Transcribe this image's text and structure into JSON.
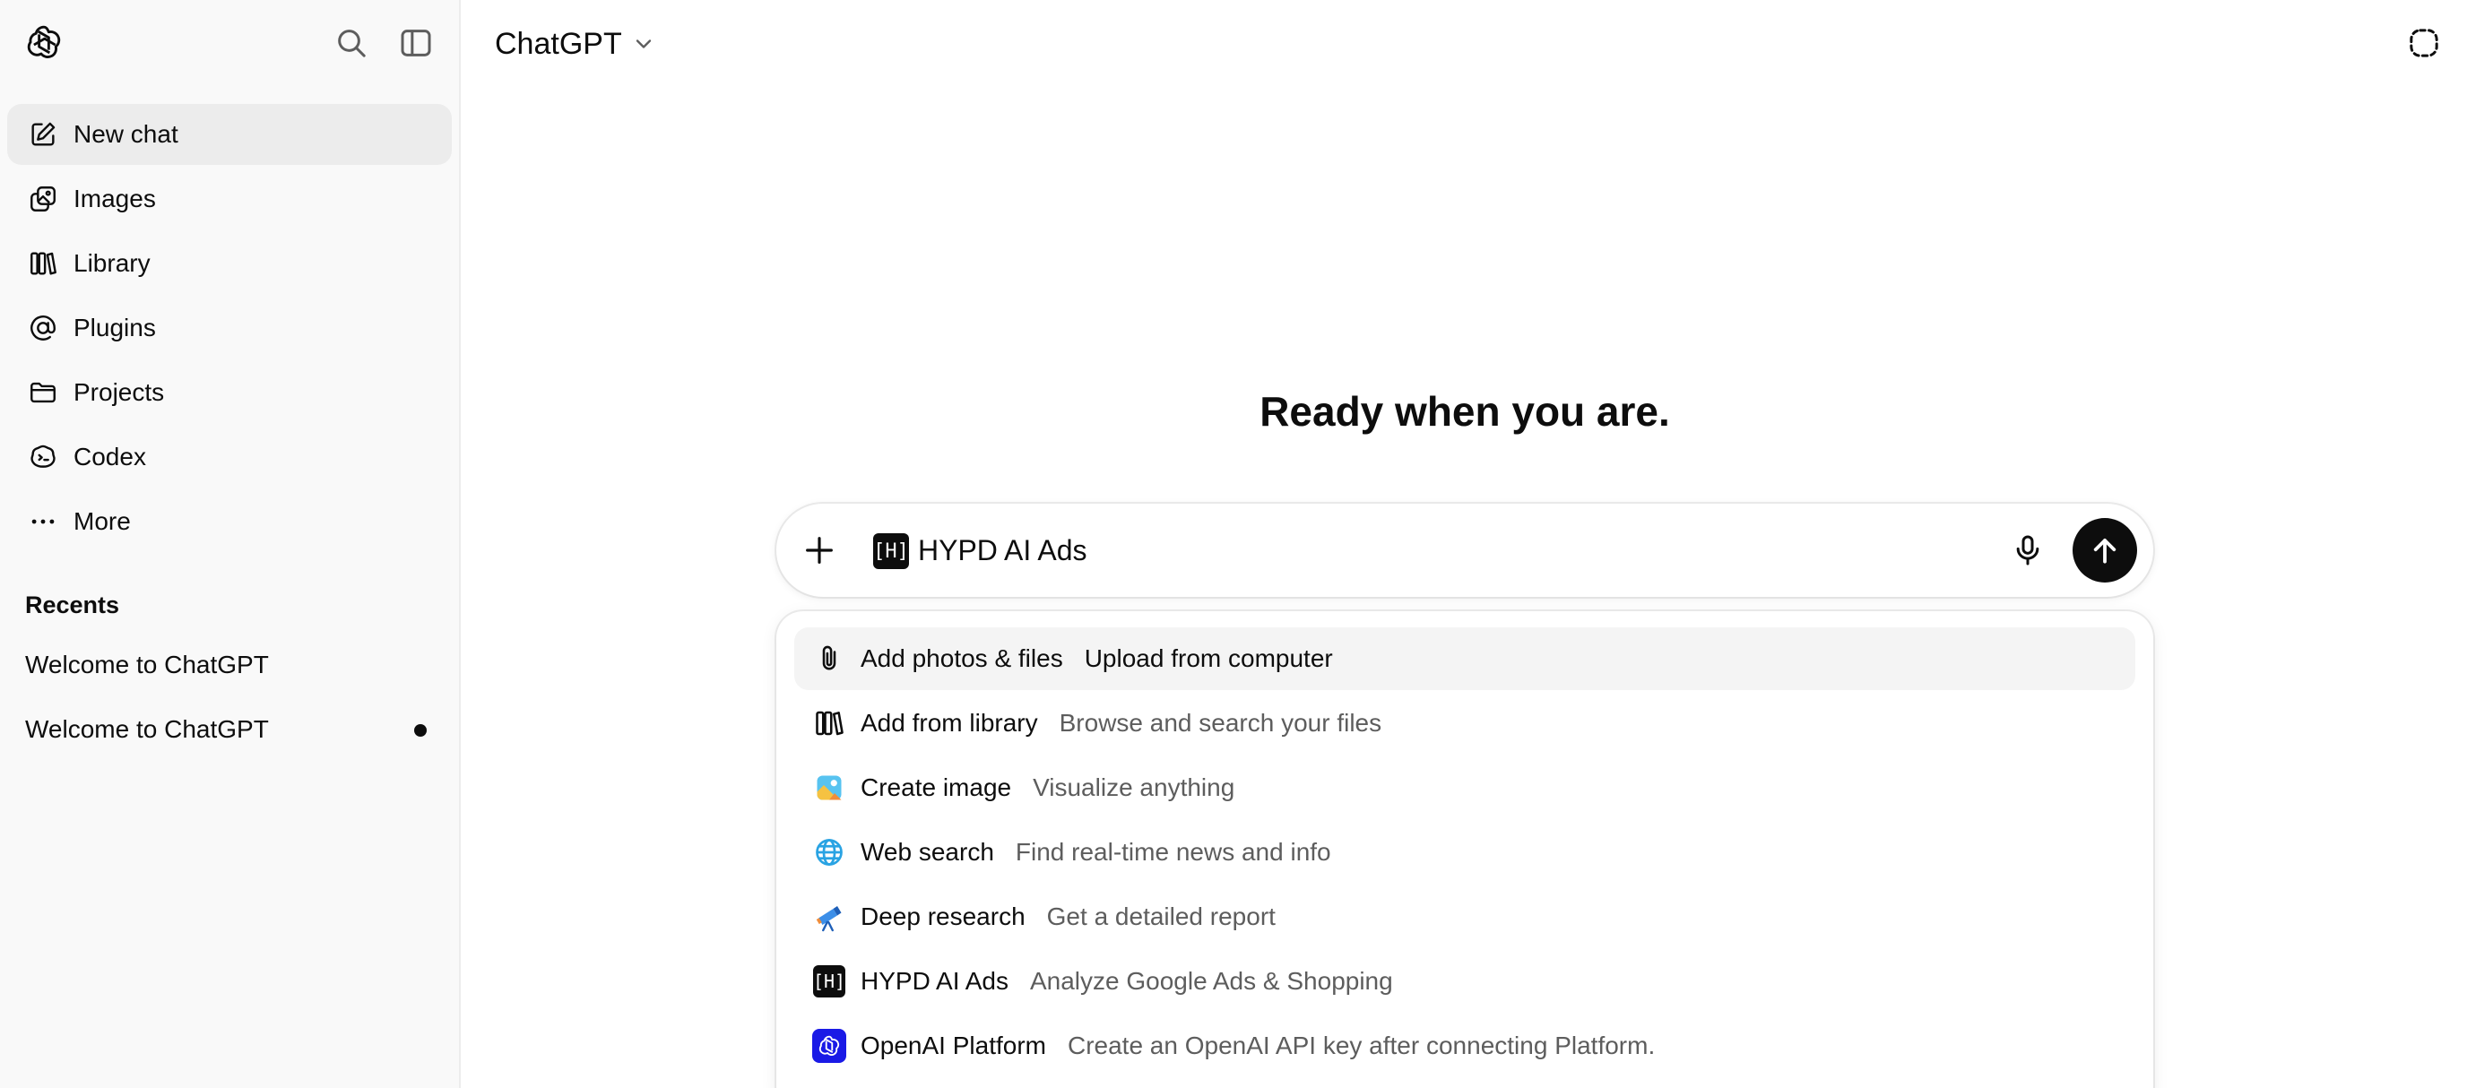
{
  "sidebar": {
    "logo_icon": "openai-logo-icon",
    "search_icon": "search-icon",
    "toggle_icon": "sidebar-toggle-icon",
    "nav": [
      {
        "label": "New chat",
        "icon": "edit-icon",
        "active": true
      },
      {
        "label": "Images",
        "icon": "images-icon"
      },
      {
        "label": "Library",
        "icon": "library-icon"
      },
      {
        "label": "Plugins",
        "icon": "at-icon"
      },
      {
        "label": "Projects",
        "icon": "folder-icon"
      },
      {
        "label": "Codex",
        "icon": "codex-icon"
      },
      {
        "label": "More",
        "icon": "more-icon"
      }
    ],
    "recents_title": "Recents",
    "recents": [
      {
        "label": "Welcome to ChatGPT",
        "unread": false
      },
      {
        "label": "Welcome to ChatGPT",
        "unread": true
      }
    ]
  },
  "header": {
    "model_label": "ChatGPT",
    "chevron_icon": "chevron-down-icon",
    "temporary_chat_icon": "temporary-chat-icon"
  },
  "main": {
    "headline": "Ready when you are."
  },
  "composer": {
    "plus_icon": "plus-icon",
    "chip_icon_text": "[H]",
    "chip_label": "HYPD AI Ads",
    "mic_icon": "mic-icon",
    "send_icon": "arrow-up-icon"
  },
  "menu": {
    "items": [
      {
        "label": "Add photos & files",
        "desc": "Upload from computer",
        "icon": "paperclip-icon",
        "highlight": true
      },
      {
        "label": "Add from library",
        "desc": "Browse and search your files",
        "icon": "library-icon"
      },
      {
        "label": "Create image",
        "desc": "Visualize anything",
        "icon": "image-create-icon"
      },
      {
        "label": "Web search",
        "desc": "Find real-time news and info",
        "icon": "globe-icon"
      },
      {
        "label": "Deep research",
        "desc": "Get a detailed report",
        "icon": "telescope-icon"
      },
      {
        "label": "HYPD AI Ads",
        "desc": "Analyze Google Ads & Shopping",
        "icon": "hypd-icon"
      },
      {
        "label": "OpenAI Platform",
        "desc": "Create an OpenAI API key after connecting Platform.",
        "icon": "openai-platform-icon"
      }
    ],
    "hypd_icon_text": "[H]"
  },
  "colors": {
    "sidebar_bg": "#f9f9f9",
    "active_item_bg": "#ececec",
    "menu_highlight_bg": "#f4f4f4",
    "send_button": "#0d0d0d",
    "openai_platform_blue": "#1a1ae6",
    "web_search_blue": "#29a3e3"
  }
}
